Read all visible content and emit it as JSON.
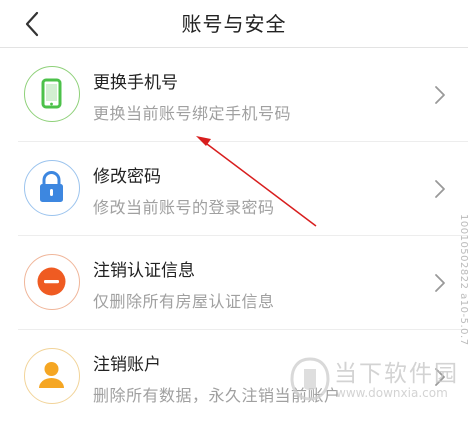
{
  "header": {
    "title": "账号与安全",
    "back_icon": "chevron-left-icon"
  },
  "items": [
    {
      "title": "更换手机号",
      "description": "更换当前账号绑定手机号码",
      "icon": "phone-icon",
      "ring_color": "#8fd17a",
      "icon_color": "#4cc14a"
    },
    {
      "title": "修改密码",
      "description": "修改当前账号的登录密码",
      "icon": "lock-icon",
      "ring_color": "#9cc4ee",
      "icon_color": "#3d87e0"
    },
    {
      "title": "注销认证信息",
      "description": "仅删除所有房屋认证信息",
      "icon": "minus-circle-icon",
      "ring_color": "#f0b69a",
      "icon_color": "#ef5b22"
    },
    {
      "title": "注销账户",
      "description": "删除所有数据，永久注销当前账户",
      "icon": "user-icon",
      "ring_color": "#f2d49a",
      "icon_color": "#f5a623"
    }
  ],
  "annotation": {
    "arrow_color": "#d81e1e"
  },
  "side_code": "10010502822 a10-5.0.7",
  "watermark": {
    "title": "当下软件园",
    "url": "www.downxia.com"
  }
}
